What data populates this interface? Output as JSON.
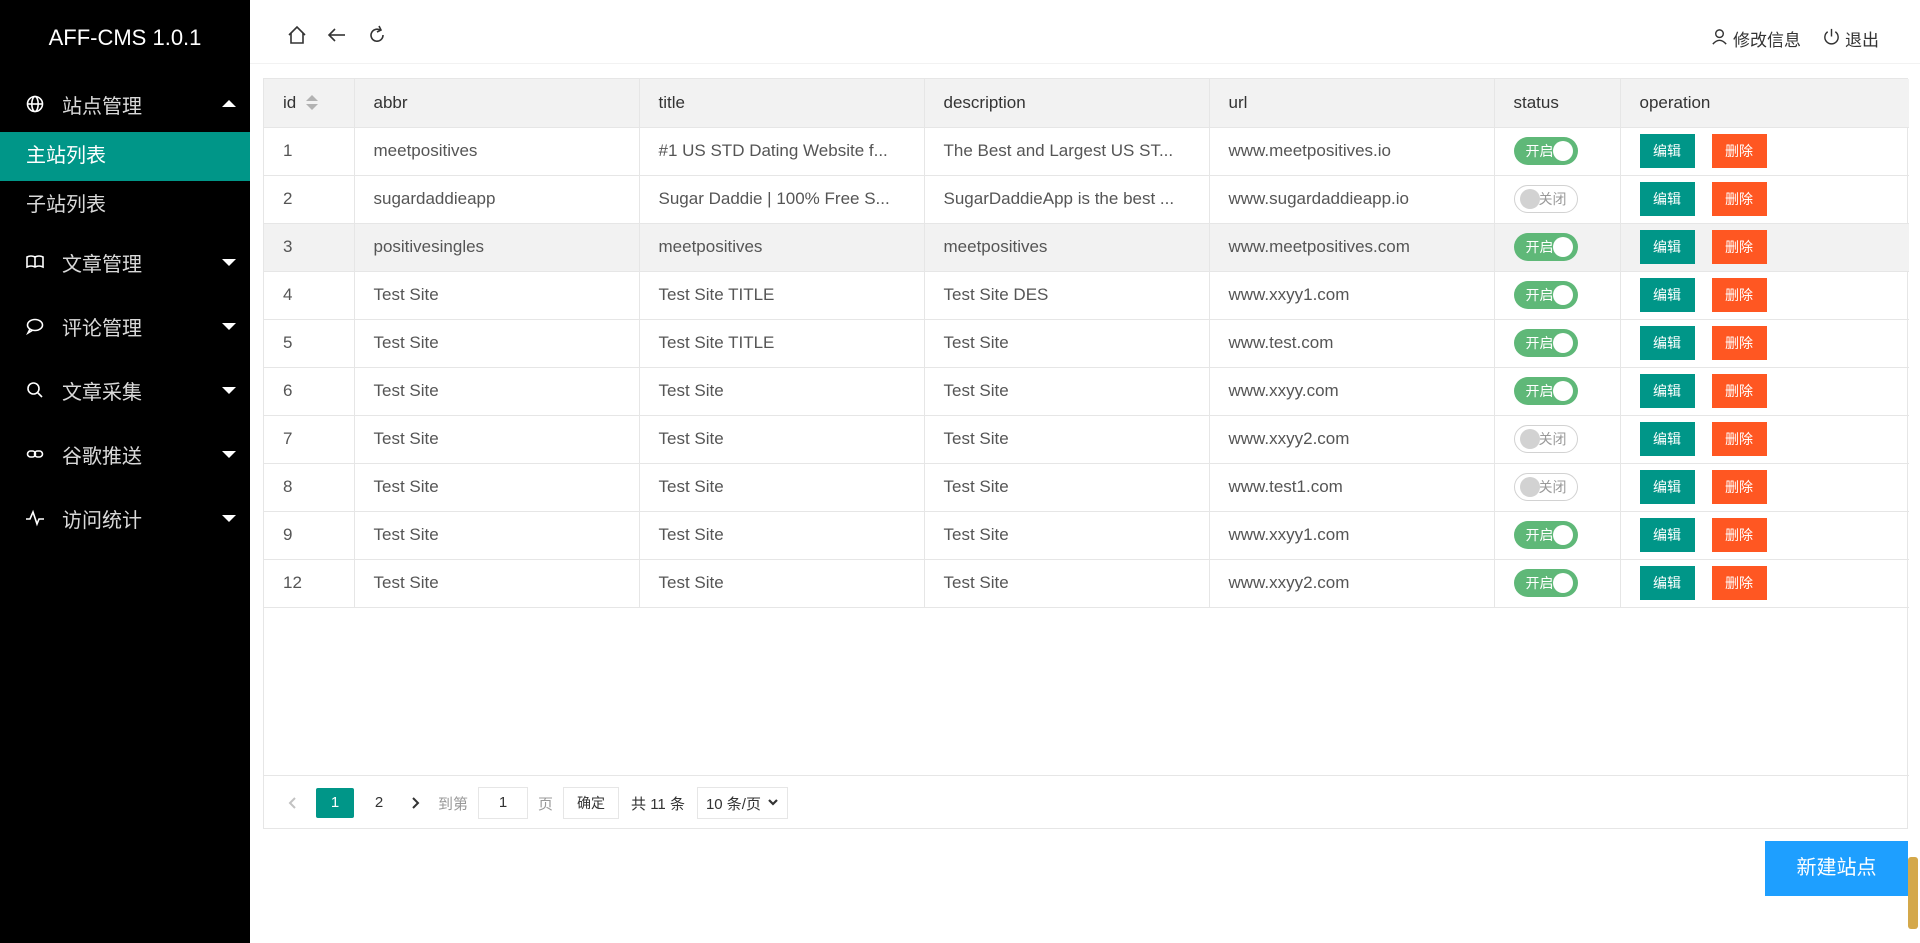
{
  "app": {
    "title": "AFF-CMS 1.0.1"
  },
  "sidebar": {
    "groups": [
      {
        "label": "站点管理",
        "icon": "globe-icon",
        "expanded": true,
        "children": [
          {
            "label": "主站列表",
            "active": true
          },
          {
            "label": "子站列表",
            "active": false
          }
        ]
      },
      {
        "label": "文章管理",
        "icon": "book-icon"
      },
      {
        "label": "评论管理",
        "icon": "comment-icon"
      },
      {
        "label": "文章采集",
        "icon": "search-icon"
      },
      {
        "label": "谷歌推送",
        "icon": "link-icon"
      },
      {
        "label": "访问统计",
        "icon": "pulse-icon"
      }
    ]
  },
  "header": {
    "icons": [
      "home-icon",
      "back-icon",
      "refresh-icon"
    ],
    "edit_info": "修改信息",
    "logout": "退出"
  },
  "table": {
    "columns": [
      "id",
      "abbr",
      "title",
      "description",
      "url",
      "status",
      "operation"
    ],
    "rows": [
      {
        "id": "1",
        "abbr": "meetpositives",
        "title": "#1 US STD Dating Website f...",
        "description": "The Best and Largest US ST...",
        "url": "www.meetpositives.io",
        "status": "开启"
      },
      {
        "id": "2",
        "abbr": "sugardaddieapp",
        "title": "Sugar Daddie | 100% Free S...",
        "description": "SugarDaddieApp is the best ...",
        "url": "www.sugardaddieapp.io",
        "status": "关闭"
      },
      {
        "id": "3",
        "abbr": "positivesingles",
        "title": "meetpositives",
        "description": "meetpositives",
        "url": "www.meetpositives.com",
        "status": "开启"
      },
      {
        "id": "4",
        "abbr": "Test Site",
        "title": "Test Site TITLE",
        "description": "Test Site DES",
        "url": "www.xxyy1.com",
        "status": "开启"
      },
      {
        "id": "5",
        "abbr": "Test Site",
        "title": "Test Site TITLE",
        "description": "Test Site",
        "url": "www.test.com",
        "status": "开启"
      },
      {
        "id": "6",
        "abbr": "Test Site",
        "title": "Test Site",
        "description": "Test Site",
        "url": "www.xxyy.com",
        "status": "开启"
      },
      {
        "id": "7",
        "abbr": "Test Site",
        "title": "Test Site",
        "description": "Test Site",
        "url": "www.xxyy2.com",
        "status": "关闭"
      },
      {
        "id": "8",
        "abbr": "Test Site",
        "title": "Test Site",
        "description": "Test Site",
        "url": "www.test1.com",
        "status": "关闭"
      },
      {
        "id": "9",
        "abbr": "Test Site",
        "title": "Test Site",
        "description": "Test Site",
        "url": "www.xxyy1.com",
        "status": "开启"
      },
      {
        "id": "12",
        "abbr": "Test Site",
        "title": "Test Site",
        "description": "Test Site",
        "url": "www.xxyy2.com",
        "status": "开启"
      }
    ],
    "actions": {
      "edit": "编辑",
      "delete": "删除"
    }
  },
  "pagination": {
    "pages": [
      "1",
      "2"
    ],
    "current": "1",
    "goto_label": "到第",
    "goto_value": "1",
    "page_suffix": "页",
    "confirm": "确定",
    "total": "共 11 条",
    "per_page": "10 条/页"
  },
  "new_site_button": "新建站点",
  "colors": {
    "sidebar_bg": "#000000",
    "active": "#009688",
    "danger": "#ff5722",
    "switch_on": "#5fb878",
    "primary": "#1e9fff"
  }
}
